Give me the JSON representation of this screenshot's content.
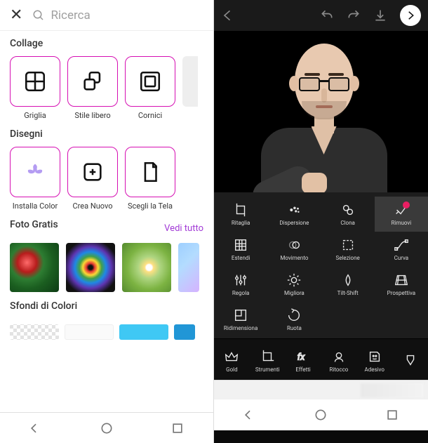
{
  "left": {
    "search_placeholder": "Ricerca",
    "sections": {
      "collage": {
        "title": "Collage",
        "items": [
          {
            "label": "Griglia",
            "icon": "grid"
          },
          {
            "label": "Stile libero",
            "icon": "freestyle"
          },
          {
            "label": "Cornici",
            "icon": "frames"
          }
        ]
      },
      "disegni": {
        "title": "Disegni",
        "items": [
          {
            "label": "Installa Color",
            "icon": "lotus"
          },
          {
            "label": "Crea Nuovo",
            "icon": "plus"
          },
          {
            "label": "Scegli la Tela",
            "icon": "page"
          }
        ]
      },
      "foto": {
        "title": "Foto Gratis",
        "see_all": "Vedi tutto"
      },
      "sfondi": {
        "title": "Sfondi di Colori"
      }
    }
  },
  "right": {
    "tools_rows": [
      [
        {
          "label": "Ritaglia",
          "icon": "crop"
        },
        {
          "label": "Dispersione",
          "icon": "dispersion"
        },
        {
          "label": "Clona",
          "icon": "clone"
        },
        {
          "label": "Rimuovi",
          "icon": "remove",
          "highlighted": true,
          "badge": true
        }
      ],
      [
        {
          "label": "Estendi",
          "icon": "stretch"
        },
        {
          "label": "Movimento",
          "icon": "motion"
        },
        {
          "label": "Selezione",
          "icon": "selection"
        },
        {
          "label": "Curva",
          "icon": "curve"
        }
      ],
      [
        {
          "label": "Regola",
          "icon": "adjust"
        },
        {
          "label": "Migliora",
          "icon": "enhance"
        },
        {
          "label": "Tilt-Shift",
          "icon": "tiltshift"
        },
        {
          "label": "Prospettiva",
          "icon": "perspective"
        }
      ],
      [
        {
          "label": "Ridimensiona",
          "icon": "resize"
        },
        {
          "label": "Ruota",
          "icon": "rotate"
        }
      ]
    ],
    "bottom_tools": [
      {
        "label": "Gold",
        "icon": "crown"
      },
      {
        "label": "Strumenti",
        "icon": "crop2"
      },
      {
        "label": "Effetti",
        "icon": "fx"
      },
      {
        "label": "Ritocco",
        "icon": "retouch"
      },
      {
        "label": "Adesivo",
        "icon": "sticker"
      },
      {
        "label": "",
        "icon": "more"
      }
    ]
  }
}
